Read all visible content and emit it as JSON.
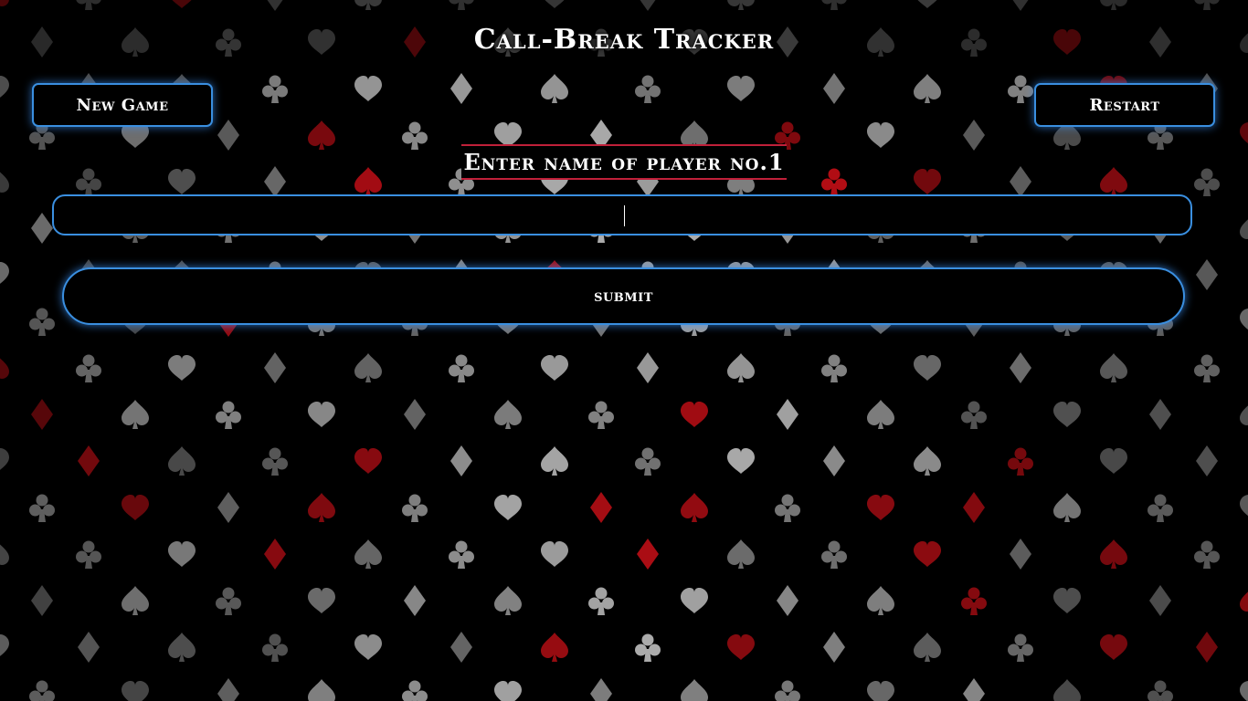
{
  "app": {
    "title": "Call-Break Tracker"
  },
  "toolbar": {
    "new_game_label": "New Game",
    "restart_label": "Restart"
  },
  "form": {
    "prompt": "Enter name of player no.1",
    "input_value": "",
    "input_placeholder": "",
    "submit_label": "submit"
  },
  "theme": {
    "accent": "#3a8fe0",
    "prompt_border": "#c0203a",
    "suit_red": "#d01018",
    "suit_grey": "#9a9a9a",
    "background": "#000000"
  },
  "background_pattern": {
    "suits": [
      "spade-icon",
      "club-icon",
      "heart-icon",
      "diamond-icon"
    ]
  }
}
